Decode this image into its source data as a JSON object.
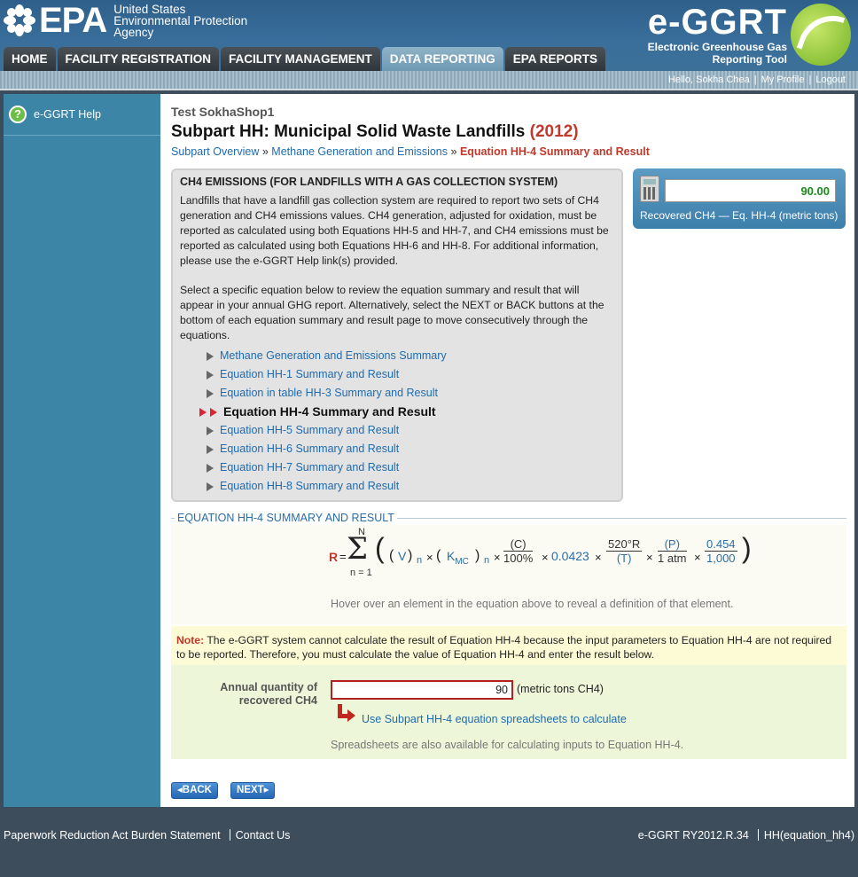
{
  "header": {
    "epa_word": "EPA",
    "epa_agency_line1": "United States",
    "epa_agency_line2": "Environmental Protection",
    "epa_agency_line3": "Agency",
    "brand_title": "e-GGRT",
    "brand_sub_line1": "Electronic Greenhouse Gas",
    "brand_sub_line2": "Reporting Tool"
  },
  "nav": {
    "tabs": [
      {
        "label": "HOME"
      },
      {
        "label": "FACILITY REGISTRATION"
      },
      {
        "label": "FACILITY MANAGEMENT"
      },
      {
        "label": "DATA REPORTING"
      },
      {
        "label": "EPA REPORTS"
      }
    ],
    "active": "DATA REPORTING"
  },
  "userbar": {
    "greeting": "Hello, Sokha Chea",
    "profile": "My Profile",
    "logout": "Logout"
  },
  "sidebar": {
    "help_label": "e-GGRT Help"
  },
  "main": {
    "facility": "Test SokhaShop1",
    "title": "Subpart HH: Municipal Solid Waste Landfills",
    "year": "(2012)",
    "crumbs": {
      "overview": "Subpart Overview",
      "sep": "»",
      "methane": "Methane Generation and Emissions",
      "current": "Equation HH-4 Summary and Result"
    }
  },
  "info": {
    "heading": "CH4 EMISSIONS (FOR LANDFILLS WITH A GAS COLLECTION SYSTEM)",
    "para1": "Landfills that have a landfill gas collection system are required to report two sets of CH4 generation and CH4 emissions values. CH4 generation, adjusted for oxidation, must be reported as calculated using both Equations HH-5 and HH-7, and CH4 emissions must be reported as calculated using both Equations HH-6 and HH-8. For additional information, please use the e-GGRT Help link(s) provided.",
    "para2": "Select a specific equation below to review the equation summary and result that will appear in your annual GHG report. Alternatively, select the NEXT or BACK buttons at the bottom of each equation summary and result page to move consecutively through the equations.",
    "links": [
      "Methane Generation and Emissions Summary",
      "Equation HH-1 Summary and Result",
      "Equation in table HH-3 Summary and Result",
      "Equation HH-4 Summary and Result",
      "Equation HH-5 Summary and Result",
      "Equation HH-6 Summary and Result",
      "Equation HH-7 Summary and Result",
      "Equation HH-8 Summary and Result"
    ],
    "current_index": 3
  },
  "result": {
    "value": "90.00",
    "label": "Recovered CH4 — Eq. HH-4 (metric tons)"
  },
  "equation": {
    "legend": "EQUATION HH-4 SUMMARY AND RESULT",
    "R": "R",
    "eq": "=",
    "sum_upper": "N",
    "sum_lower": "n = 1",
    "V": "V",
    "n_sub": "n",
    "K": "K",
    "K_sub": "MC",
    "times": "×",
    "C_num": "(C)",
    "C_den": "100%",
    "const": "0.0423",
    "T_num": "520°R",
    "T_den": "(T)",
    "P_num": "(P)",
    "P_den": "1 atm",
    "conv_num": "0.454",
    "conv_den": "1,000",
    "hover_note": "Hover over an element in the equation above to reveal a definition of that element."
  },
  "note": {
    "label": "Note:",
    "text": " The e-GGRT system cannot calculate the result of Equation HH-4 because the input parameters to Equation HH-4 are not required to be reported. Therefore, you must calculate the value of Equation HH-4 and enter the result below."
  },
  "entry": {
    "label_line1": "Annual quantity of",
    "label_line2": "recovered CH4",
    "value": "90",
    "unit": "(metric tons CH4)",
    "link": "Use Subpart HH-4 equation spreadsheets to calculate",
    "foot": "Spreadsheets are also available for calculating inputs to Equation HH-4."
  },
  "buttons": {
    "back": "◂BACK",
    "next": "NEXT▸"
  },
  "footer": {
    "paperwork": "Paperwork Reduction Act Burden Statement",
    "contact": "Contact Us",
    "version": "e-GGRT RY2012.R.34",
    "page_id": "HH(equation_hh4)"
  }
}
